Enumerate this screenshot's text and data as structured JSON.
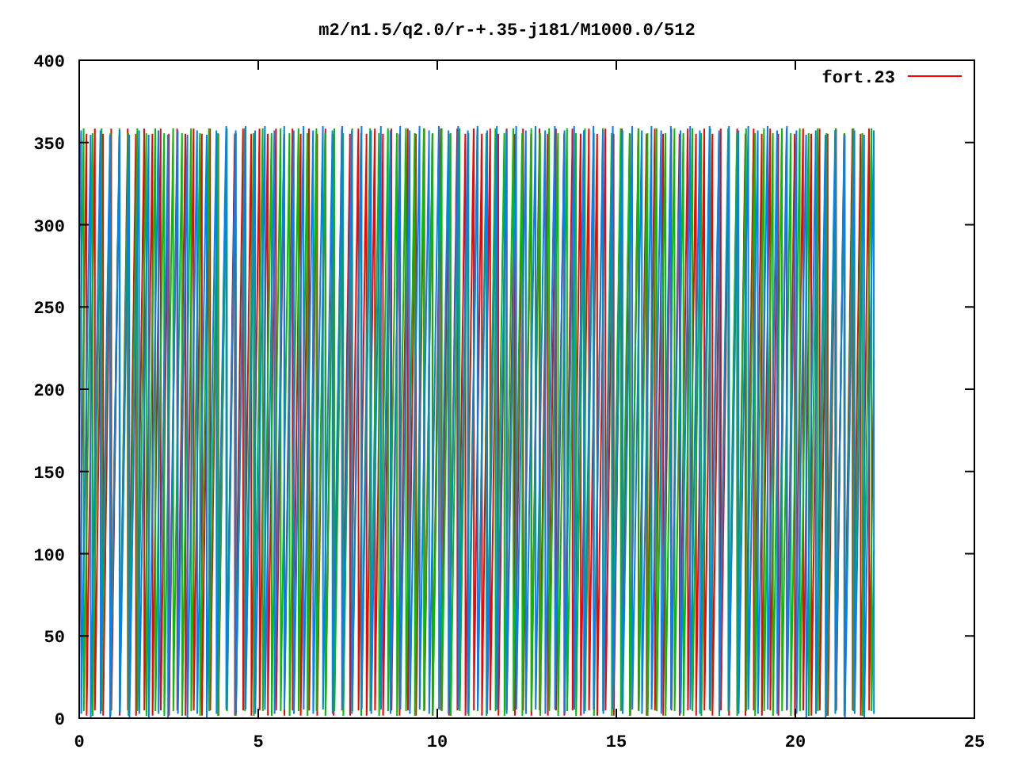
{
  "chart": {
    "title": "m2/n1.5/q2.0/r-+.35-j181/M1000.0/512",
    "legend": {
      "label": "fort.23"
    },
    "x_ticks": [
      "0",
      "5",
      "10",
      "15",
      "20",
      "25"
    ],
    "y_ticks": [
      "400",
      "350",
      "300",
      "250",
      "200",
      "150",
      "100",
      "50",
      "0"
    ]
  }
}
